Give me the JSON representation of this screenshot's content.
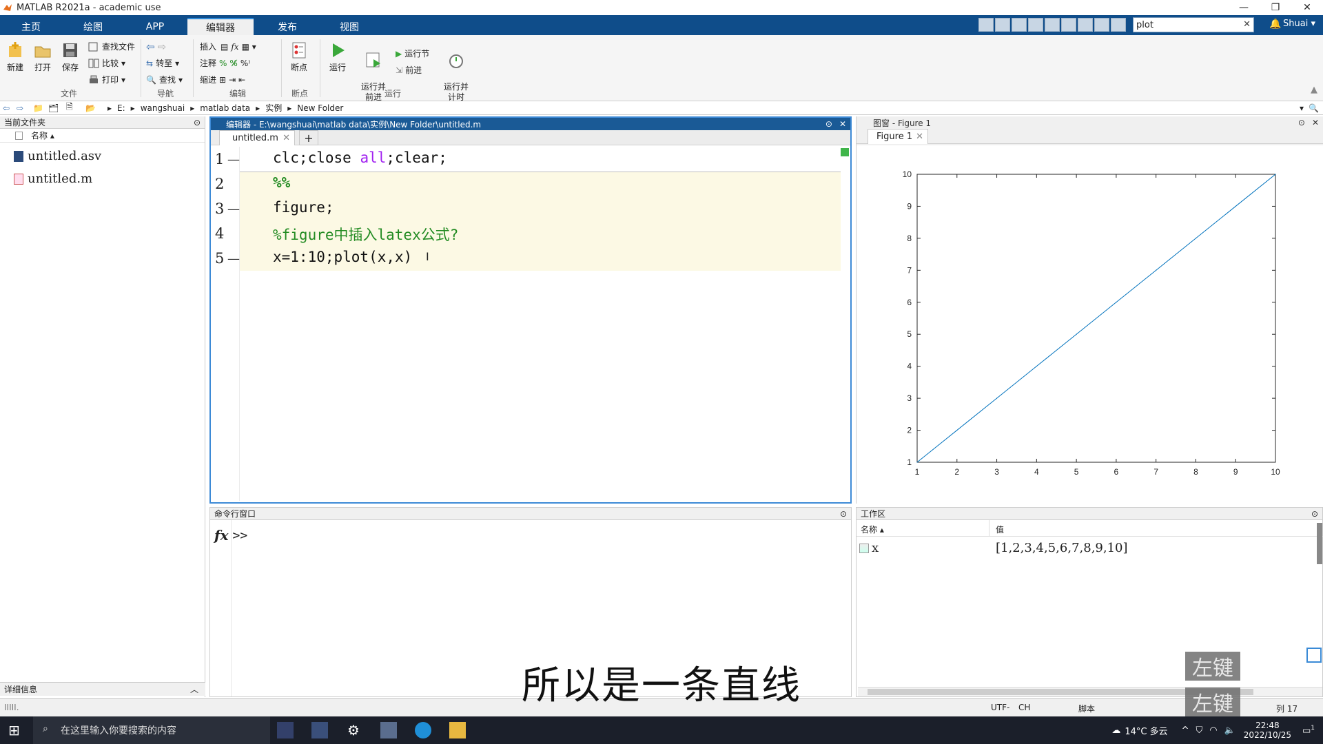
{
  "window": {
    "title": "MATLAB R2021a - academic use"
  },
  "tabs": [
    {
      "label": "主页"
    },
    {
      "label": "绘图"
    },
    {
      "label": "APP"
    },
    {
      "label": "编辑器"
    },
    {
      "label": "发布"
    },
    {
      "label": "视图"
    }
  ],
  "active_tab": "编辑器",
  "search": {
    "value": "plot"
  },
  "user": {
    "name": "Shuai ▾"
  },
  "ribbon": {
    "file": {
      "new": "新建",
      "open": "打开",
      "save": "保存",
      "find_files": "查找文件",
      "compare": "比较",
      "print": "打印",
      "group": "文件"
    },
    "nav": {
      "goto": "转至",
      "find": "查找",
      "group": "导航"
    },
    "edit": {
      "insert": "插入",
      "comment": "注释",
      "indent": "缩进",
      "group": "编辑"
    },
    "breakpoints": {
      "label": "断点",
      "group": "断点"
    },
    "run": {
      "run": "运行",
      "run_advance": "运行并\n前进",
      "run_section": "运行节",
      "advance": "前进",
      "run_time": "运行并\n计时",
      "group": "运行"
    }
  },
  "address": {
    "crumbs": [
      "E:",
      "wangshuai",
      "matlab data",
      "实例",
      "New Folder"
    ]
  },
  "current_folder": {
    "title": "当前文件夹",
    "column": "名称 ▴",
    "files": [
      {
        "name": "untitled.asv"
      },
      {
        "name": "untitled.m"
      }
    ],
    "details": "详细信息"
  },
  "editor": {
    "title": "编辑器 - E:\\wangshuai\\matlab data\\实例\\New Folder\\untitled.m",
    "tab": "untitled.m",
    "lines": [
      {
        "num": "1",
        "dash": "—",
        "parts": [
          {
            "t": "clc;close ",
            "c": "#111"
          },
          {
            "t": "all",
            "c": "#a020f0"
          },
          {
            "t": ";clear;",
            "c": "#111"
          }
        ]
      },
      {
        "num": "2",
        "dash": "",
        "parts": [
          {
            "t": "%%",
            "c": "#228b22",
            "b": true
          }
        ]
      },
      {
        "num": "3",
        "dash": "—",
        "parts": [
          {
            "t": "figure;",
            "c": "#111"
          }
        ]
      },
      {
        "num": "4",
        "dash": "",
        "parts": [
          {
            "t": "%figure中插入latex公式?",
            "c": "#228b22"
          }
        ]
      },
      {
        "num": "5",
        "dash": "—",
        "parts": [
          {
            "t": "x=1:10;plot(x,x)",
            "c": "#111"
          }
        ]
      }
    ]
  },
  "figure": {
    "title": "图窗 - Figure 1",
    "tab": "Figure 1"
  },
  "chart_data": {
    "type": "line",
    "x": [
      1,
      2,
      3,
      4,
      5,
      6,
      7,
      8,
      9,
      10
    ],
    "series": [
      {
        "values": [
          1,
          2,
          3,
          4,
          5,
          6,
          7,
          8,
          9,
          10
        ],
        "color": "#0072bd"
      }
    ],
    "xlim": [
      1,
      10
    ],
    "ylim": [
      1,
      10
    ],
    "xticks": [
      1,
      2,
      3,
      4,
      5,
      6,
      7,
      8,
      9,
      10
    ],
    "yticks": [
      1,
      2,
      3,
      4,
      5,
      6,
      7,
      8,
      9,
      10
    ],
    "grid": false,
    "title": "",
    "xlabel": "",
    "ylabel": ""
  },
  "command_window": {
    "title": "命令行窗口",
    "fx": "fx",
    "prompt": ">>"
  },
  "workspace": {
    "title": "工作区",
    "col_name": "名称 ▴",
    "col_value": "值",
    "vars": [
      {
        "name": "x",
        "value": "[1,2,3,4,5,6,7,8,9,10]"
      }
    ]
  },
  "status": {
    "encoding": "UTF-",
    "ime": "CH",
    "mode": "脚本",
    "col": "列  17"
  },
  "subtitle": "所以是一条直线",
  "key_badges": [
    "左键",
    "左键"
  ],
  "taskbar": {
    "search_placeholder": "在这里输入你要搜索的内容",
    "weather": "14°C 多云",
    "time": "22:48",
    "date": "2022/10/25",
    "notif_count": "1"
  },
  "colors": {
    "tab_strip": "#0f4d8a",
    "editor_border": "#3d8ad6",
    "cell_bg": "#fcf9e4",
    "comment": "#228b22",
    "keyword": "#a020f0",
    "plot_line": "#0072bd"
  }
}
